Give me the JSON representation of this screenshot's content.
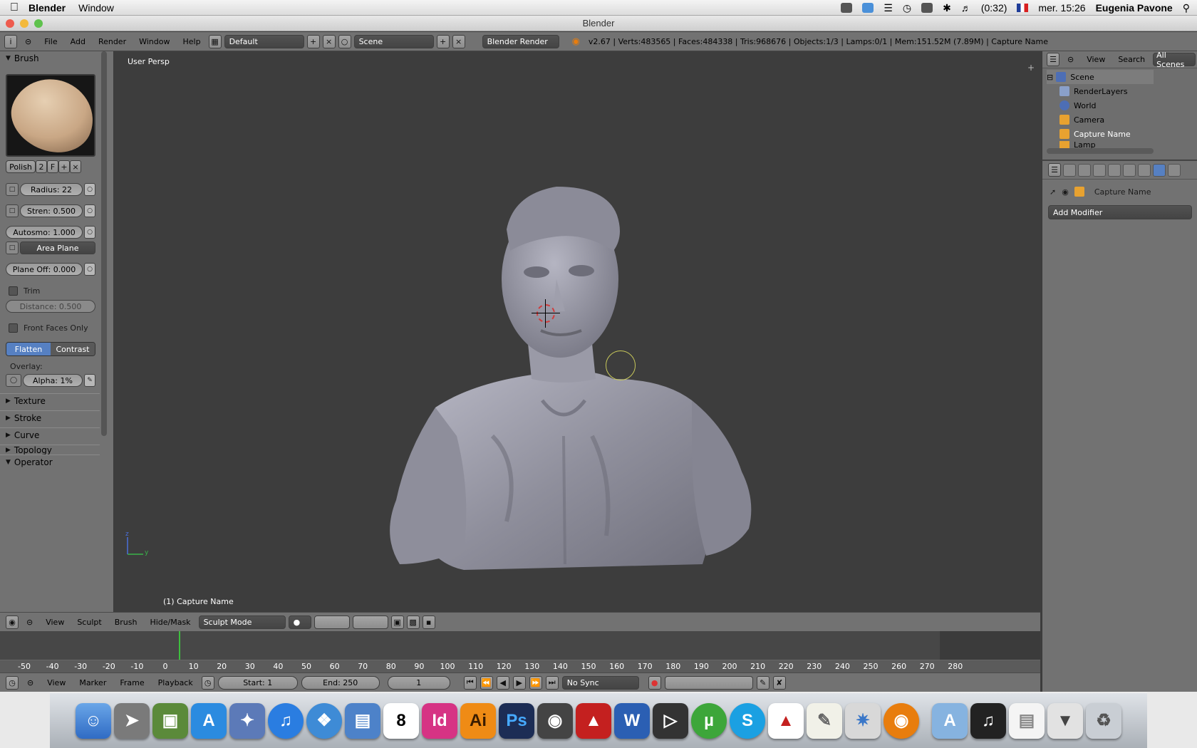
{
  "macmenu": {
    "app": "Blender",
    "items": [
      "Window"
    ],
    "battery": "(0:32)",
    "clock": "mer. 15:26",
    "user": "Eugenia Pavone"
  },
  "window": {
    "title": "Blender"
  },
  "info": {
    "menus": [
      "File",
      "Add",
      "Render",
      "Window",
      "Help"
    ],
    "screen": "Default",
    "scene": "Scene",
    "engine": "Blender Render",
    "stats": "v2.67 | Verts:483565 | Faces:484338 | Tris:968676 | Objects:1/3 | Lamps:0/1 | Mem:151.52M (7.89M) | Capture Name"
  },
  "tools": {
    "brush_header": "Brush",
    "brush_name": "Polish",
    "brush_users": "2",
    "brush_fake": "F",
    "radius": "Radius: 22",
    "strength": "Stren: 0.500",
    "autosmooth": "Autosmo: 1.000",
    "area_plane": "Area Plane",
    "plane_offset": "Plane Off: 0.000",
    "trim": "Trim",
    "distance": "Distance: 0.500",
    "front_faces": "Front Faces Only",
    "flatten": "Flatten",
    "contrast": "Contrast",
    "overlay": "Overlay:",
    "alpha": "Alpha: 1%",
    "texture": "Texture",
    "stroke": "Stroke",
    "curve": "Curve",
    "topology": "Topology",
    "operator": "Operator"
  },
  "viewport": {
    "view_label": "User Persp",
    "object_label": "(1) Capture Name"
  },
  "view3d_header": {
    "menus": [
      "View",
      "Sculpt",
      "Brush",
      "Hide/Mask"
    ],
    "mode": "Sculpt Mode"
  },
  "timeline": {
    "ticks": [
      "-50",
      "-40",
      "-30",
      "-20",
      "-10",
      "0",
      "10",
      "20",
      "30",
      "40",
      "50",
      "60",
      "70",
      "80",
      "90",
      "100",
      "110",
      "120",
      "130",
      "140",
      "150",
      "160",
      "170",
      "180",
      "190",
      "200",
      "210",
      "220",
      "230",
      "240",
      "250",
      "260",
      "270",
      "280"
    ],
    "menus": [
      "View",
      "Marker",
      "Frame",
      "Playback"
    ],
    "start": "Start: 1",
    "end": "End: 250",
    "current": "1",
    "sync": "No Sync"
  },
  "outliner": {
    "menus": [
      "View",
      "Search"
    ],
    "filter": "All Scenes",
    "items": [
      "Scene",
      "RenderLayers",
      "World",
      "Camera",
      "Capture Name",
      "Lamp"
    ]
  },
  "properties": {
    "object": "Capture Name",
    "add_modifier": "Add Modifier"
  },
  "dock": {
    "apps": [
      "Finder",
      "Launchpad",
      "Photos",
      "App Store",
      "Preview",
      "iTunes",
      "Safari",
      "System",
      "Calendar",
      "InDesign",
      "Illustrator",
      "Photoshop",
      "Camera",
      "Acrobat",
      "Word",
      "Final Cut",
      "uTorrent",
      "Skype",
      "Acrobat Reader",
      "TextEdit",
      "Network",
      "Blender",
      "Applications",
      "Music",
      "Documents",
      "Downloads",
      "Trash"
    ],
    "calendar_day": "8",
    "id": "Id",
    "ai": "Ai",
    "ps": "Ps"
  }
}
